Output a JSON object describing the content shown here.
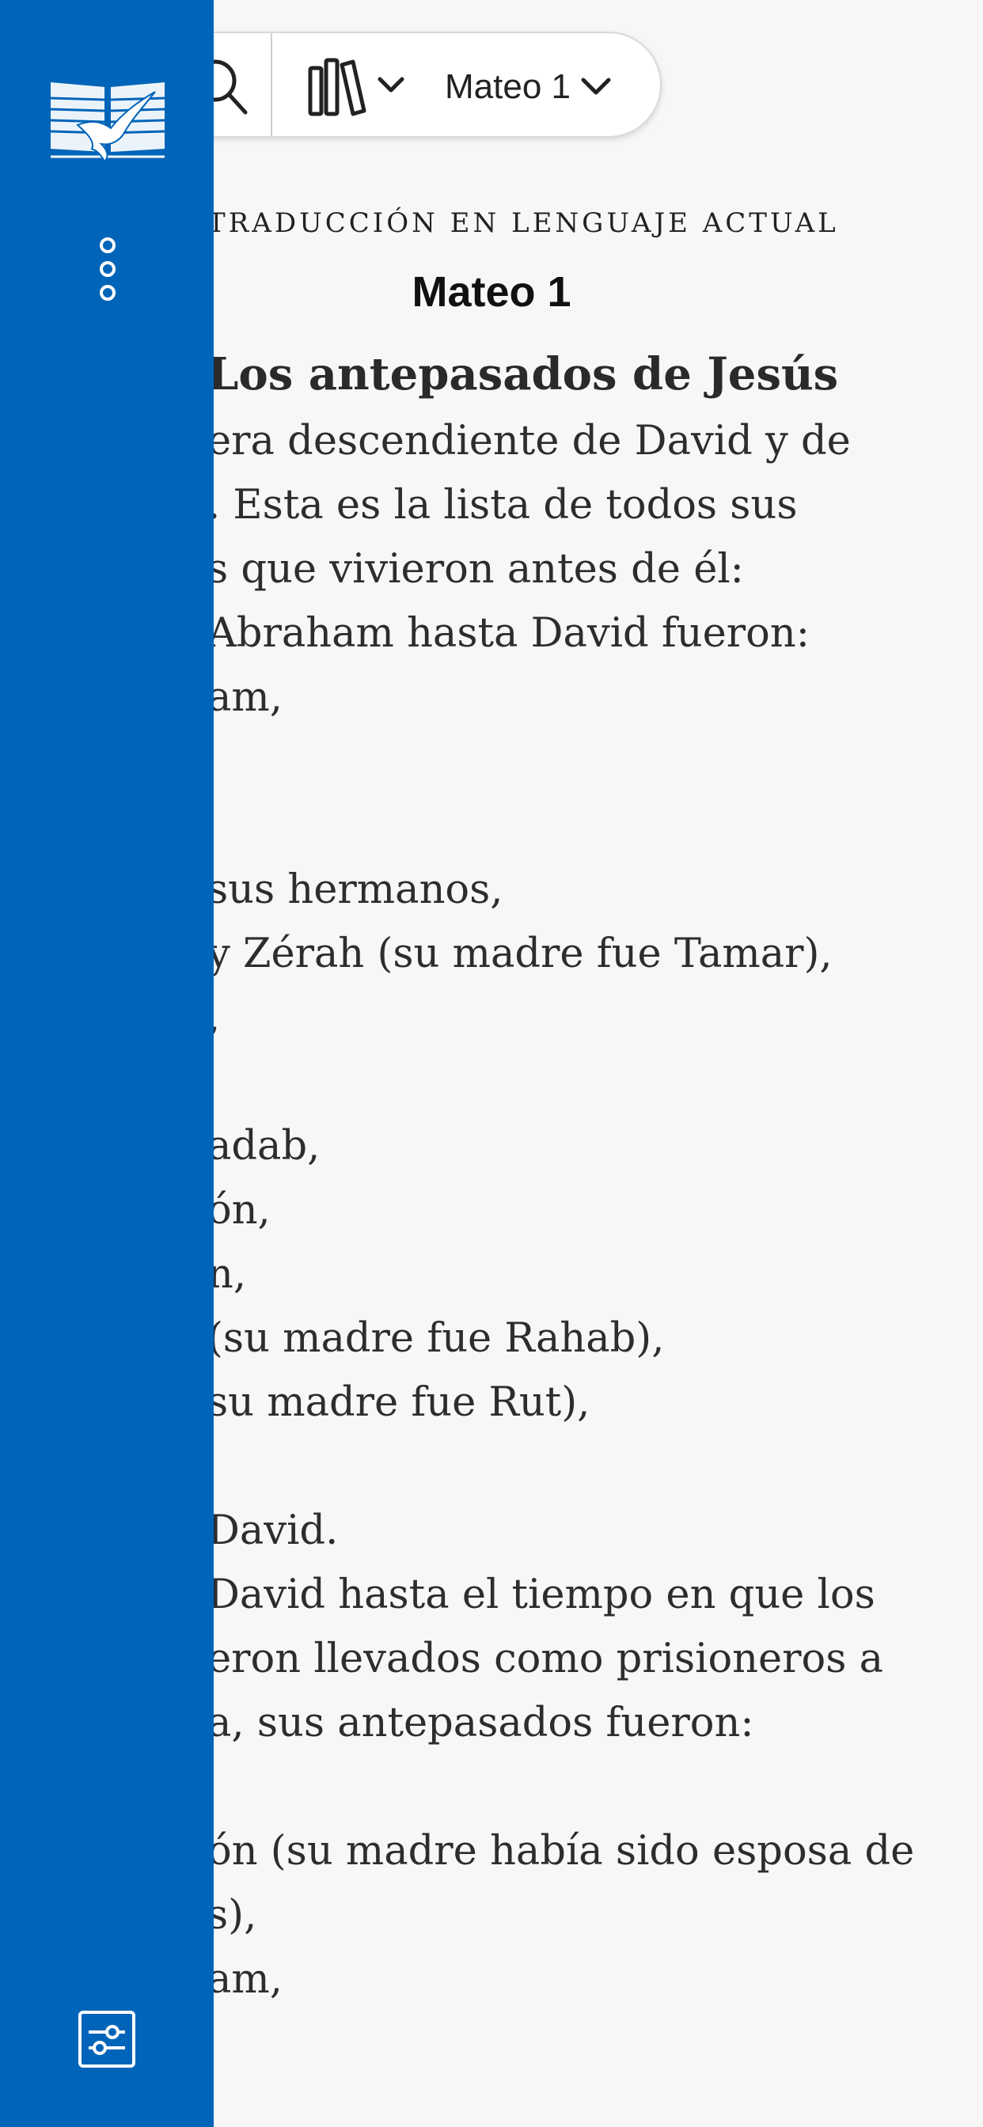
{
  "toolbar": {
    "search_icon": "search-icon",
    "library_icon": "library-icon",
    "chapter_label": "Mateo 1"
  },
  "reader": {
    "version_name": "TRADUCCIÓN EN LENGUAJE ACTUAL",
    "chapter_title": "Mateo 1",
    "section_heading": "Los antepasados de Jesús",
    "lines": [
      "era descendiente de David y de",
      ". Esta es la lista de todos sus",
      "s que vivieron antes de él:",
      "Abraham hasta David fueron:",
      "am,",
      "",
      "",
      "sus hermanos,",
      "y Zérah (su madre fue Tamar),",
      ",",
      "",
      "adab,",
      "ón,",
      "n,",
      "(su madre fue Rahab),",
      "su madre fue Rut),",
      "",
      "David.",
      "David hasta el tiempo en que los",
      "eron llevados como prisioneros a",
      "a, sus antepasados fueron:",
      "",
      "ón (su madre había sido esposa de",
      "s),",
      "am,"
    ]
  },
  "sidebar": {
    "logo_icon": "bible-dove-logo-icon",
    "more_icon": "more-vertical-icon",
    "settings_icon": "settings-sliders-icon",
    "background_color": "#0064b8"
  }
}
